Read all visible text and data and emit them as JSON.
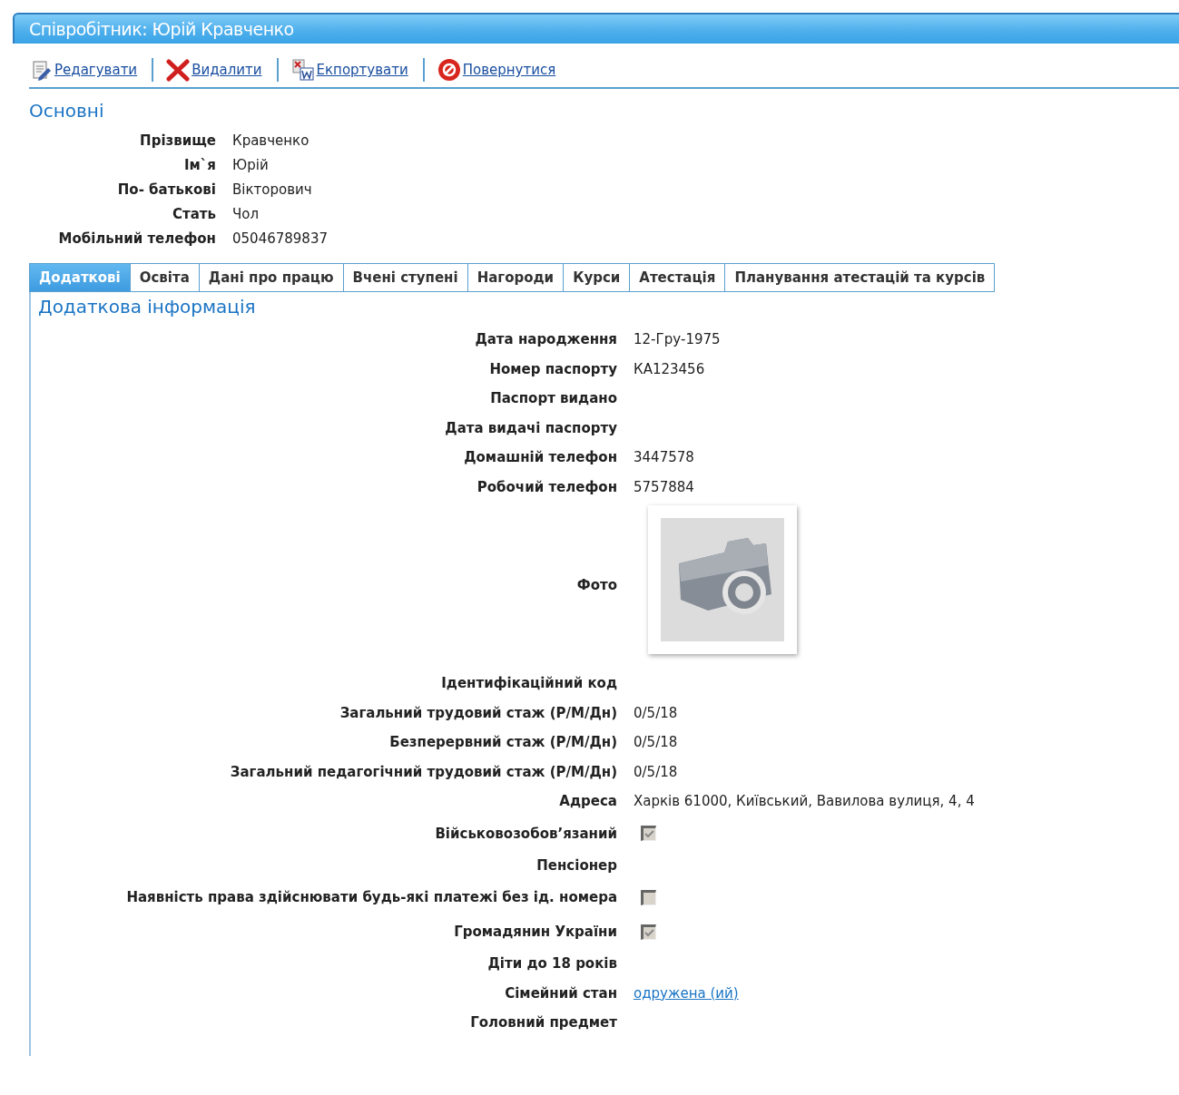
{
  "window": {
    "title": "Співробітник: Юрій Кравченко"
  },
  "toolbar": [
    {
      "kind": "edit",
      "label": "Редагувати"
    },
    {
      "kind": "delete",
      "label": "Видалити"
    },
    {
      "kind": "export",
      "label": "Екпортувати"
    },
    {
      "kind": "back",
      "label": "Повернутися"
    }
  ],
  "basic": {
    "heading": "Основні",
    "fields": [
      {
        "label": "Прізвище",
        "value": "Кравченко"
      },
      {
        "label": "Ім`я",
        "value": "Юрій"
      },
      {
        "label": "По- батькові",
        "value": "Вікторович"
      },
      {
        "label": "Стать",
        "value": "Чол"
      },
      {
        "label": "Мобільний телефон",
        "value": "05046789837"
      }
    ]
  },
  "tabs": [
    {
      "label": "Додаткові",
      "selected": true
    },
    {
      "label": "Освіта",
      "selected": false
    },
    {
      "label": "Дані про працю",
      "selected": false
    },
    {
      "label": "Вчені ступені",
      "selected": false
    },
    {
      "label": "Нагороди",
      "selected": false
    },
    {
      "label": "Курси",
      "selected": false
    },
    {
      "label": "Атестація",
      "selected": false
    },
    {
      "label": "Планування атестацій та курсів",
      "selected": false
    }
  ],
  "details": {
    "heading": "Додаткова інформація",
    "fields": [
      {
        "kind": "text",
        "label": "Дата народження",
        "value": "12-Гру-1975"
      },
      {
        "kind": "text",
        "label": "Номер паспорту",
        "value": "КА123456"
      },
      {
        "kind": "text",
        "label": "Паспорт видано"
      },
      {
        "kind": "text",
        "label": "Дата видачі паспорту"
      },
      {
        "kind": "text",
        "label": "Домашній телефон",
        "value": "3447578"
      },
      {
        "kind": "text",
        "label": "Робочий телефон",
        "value": "5757884"
      },
      {
        "kind": "photo",
        "label": "Фото"
      },
      {
        "kind": "text",
        "label": "Ідентифікаційний код"
      },
      {
        "kind": "text",
        "label": "Загальний трудовий стаж (Р/М/Дн)",
        "value": "0/5/18"
      },
      {
        "kind": "text",
        "label": "Безперервний стаж (Р/М/Дн)",
        "value": "0/5/18"
      },
      {
        "kind": "text",
        "label": "Загальний педагогічний трудовий стаж (Р/М/Дн)",
        "value": "0/5/18"
      },
      {
        "kind": "text",
        "label": "Адреса",
        "value": "Харків 61000, Київський, Вавилова вулиця, 4, 4"
      },
      {
        "kind": "checkbox",
        "label": "Військовозобов’язаний",
        "checked": true
      },
      {
        "kind": "text",
        "label": "Пенсіонер"
      },
      {
        "kind": "checkbox",
        "label": "Наявність права здійснювати будь-які платежі без ід. номера",
        "checked": false
      },
      {
        "kind": "checkbox",
        "label": "Громадянин України",
        "checked": true
      },
      {
        "kind": "text",
        "label": "Діти до 18 років"
      },
      {
        "kind": "link",
        "label": "Сімейний стан",
        "value": "одружена (ий)"
      },
      {
        "kind": "text",
        "label": "Головний предмет"
      }
    ]
  }
}
